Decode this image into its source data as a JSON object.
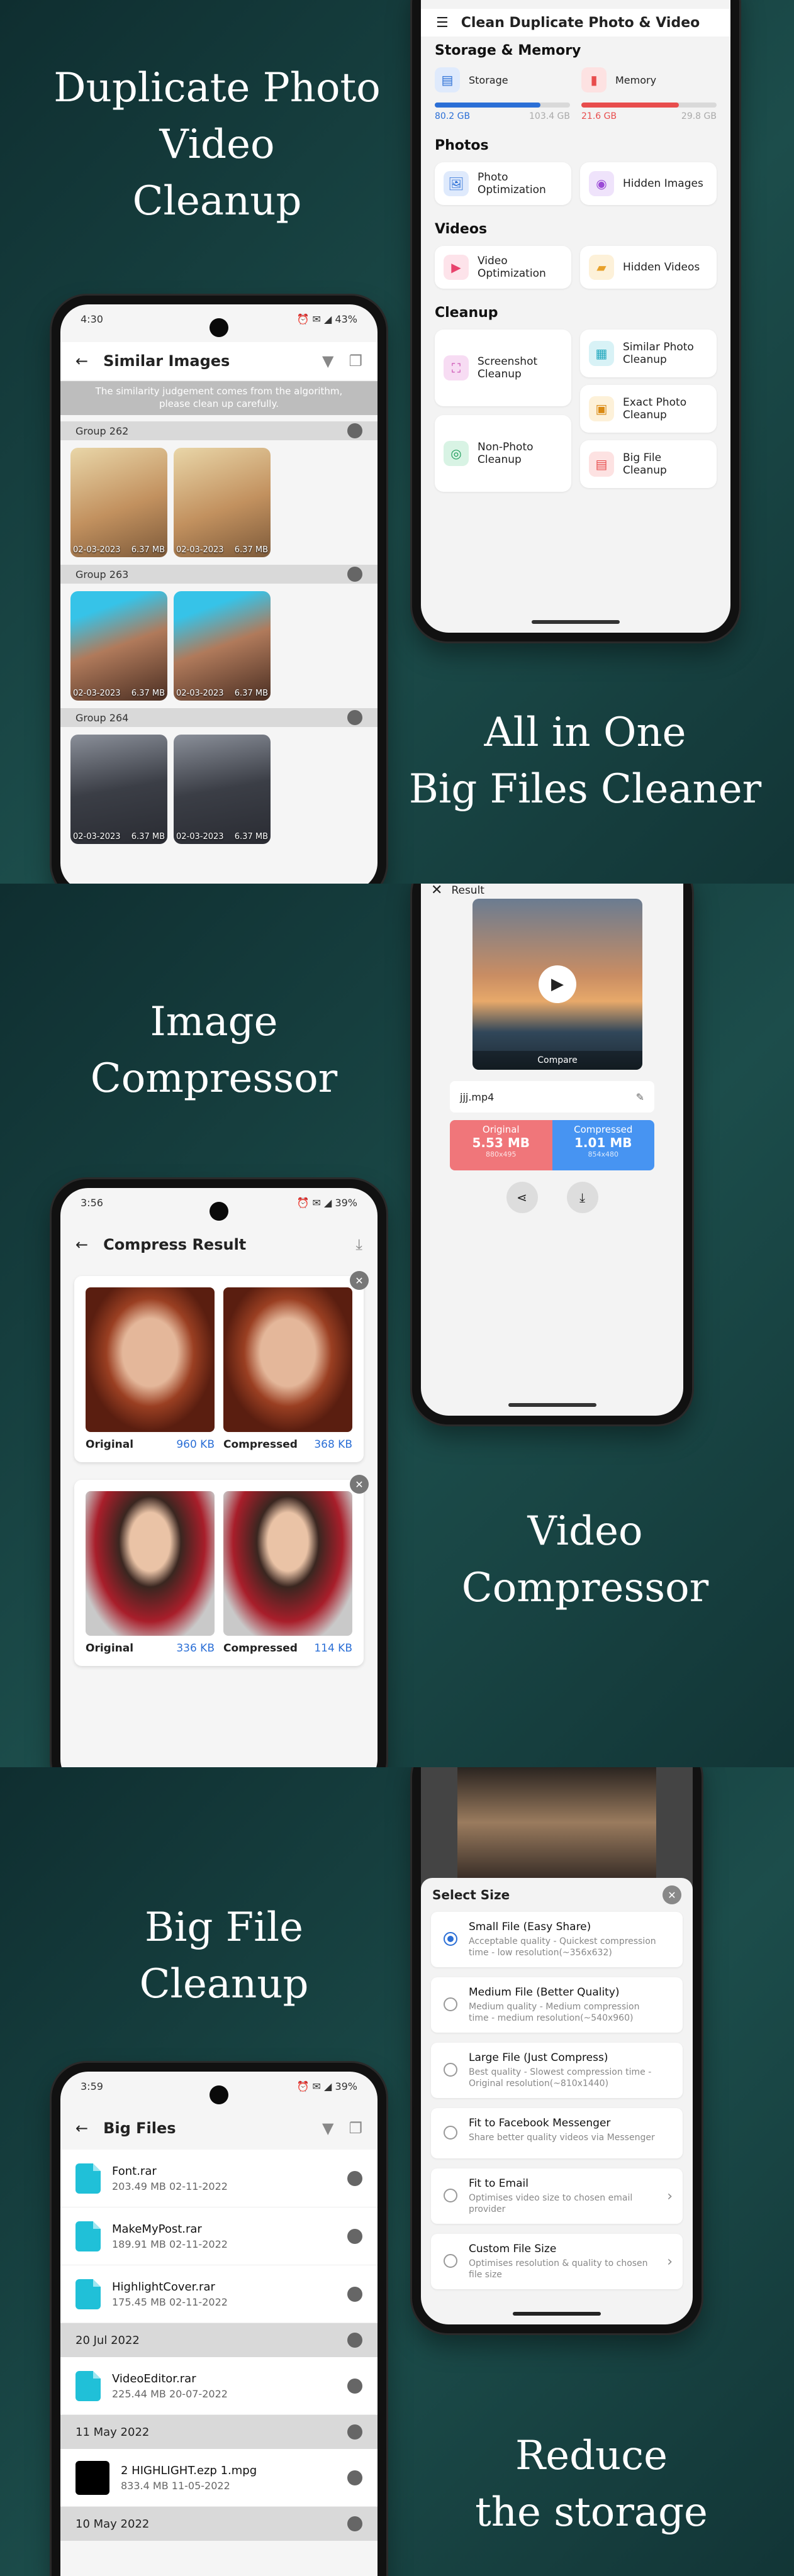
{
  "section1": {
    "headline_lines": [
      "Duplicate Photo",
      "Video",
      "Cleanup"
    ],
    "footer_lines": [
      "All in One",
      "Big Files Cleaner"
    ],
    "similar": {
      "time": "4:30",
      "status_right": "⏰ ✉ ◢ 43%",
      "title": "Similar Images",
      "notice": "The similarity judgement comes from the algorithm, please clean up carefully.",
      "groups": [
        {
          "label": "Group 262",
          "items": [
            {
              "date": "02-03-2023",
              "size": "6.37 MB"
            },
            {
              "date": "02-03-2023",
              "size": "6.37 MB"
            }
          ]
        },
        {
          "label": "Group 263",
          "items": [
            {
              "date": "02-03-2023",
              "size": "6.37 MB"
            },
            {
              "date": "02-03-2023",
              "size": "6.37 MB"
            }
          ]
        },
        {
          "label": "Group 264",
          "items": [
            {
              "date": "02-03-2023",
              "size": "6.37 MB"
            },
            {
              "date": "02-03-2023",
              "size": "6.37 MB"
            }
          ]
        }
      ]
    },
    "menu": {
      "title": "Clean Duplicate Photo & Video",
      "storage_section": "Storage & Memory",
      "storage": {
        "label": "Storage",
        "used": "80.2 GB",
        "total": "103.4 GB",
        "fill": 0.78
      },
      "memory": {
        "label": "Memory",
        "used": "21.6 GB",
        "total": "29.8 GB",
        "fill": 0.72
      },
      "photos_section": "Photos",
      "photo_optimization": "Photo Optimization",
      "hidden_images": "Hidden Images",
      "videos_section": "Videos",
      "video_optimization": "Video Optimization",
      "hidden_videos": "Hidden Videos",
      "cleanup_section": "Cleanup",
      "screenshot_cleanup": "Screenshot Cleanup",
      "similar_photo_cleanup": "Similar Photo Cleanup",
      "exact_photo_cleanup": "Exact Photo Cleanup",
      "non_photo_cleanup": "Non-Photo Cleanup",
      "big_file_cleanup": "Big File Cleanup"
    }
  },
  "section2": {
    "headline_lines": [
      "Image",
      "Compressor"
    ],
    "footer_lines": [
      "Video",
      "Compressor"
    ],
    "video_result": {
      "title": "Result",
      "compare": "Compare",
      "filename": "jjj.mp4",
      "original_label": "Original",
      "original_size": "5.53 MB",
      "original_res": "880x495",
      "compressed_label": "Compressed",
      "compressed_size": "1.01 MB",
      "compressed_res": "854x480"
    },
    "compress_result": {
      "time": "3:56",
      "status_right": "⏰ ✉ ◢ 39%",
      "title": "Compress Result",
      "pairs": [
        {
          "orig_label": "Original",
          "orig_size": "960 KB",
          "comp_label": "Compressed",
          "comp_size": "368 KB"
        },
        {
          "orig_label": "Original",
          "orig_size": "336 KB",
          "comp_label": "Compressed",
          "comp_size": "114 KB"
        }
      ]
    }
  },
  "section3": {
    "headline_lines": [
      "Big File",
      "Cleanup"
    ],
    "footer_lines": [
      "Reduce",
      "the storage"
    ],
    "select_size": {
      "title": "Select Size",
      "options": [
        {
          "title": "Small File (Easy Share)",
          "desc": "Acceptable quality - Quickest compression time - low resolution(~356x632)"
        },
        {
          "title": "Medium File (Better Quality)",
          "desc": "Medium quality - Medium compression time - medium resolution(~540x960)"
        },
        {
          "title": "Large File (Just Compress)",
          "desc": "Best quality - Slowest compression time - Original resolution(~810x1440)"
        },
        {
          "title": "Fit to Facebook Messenger",
          "desc": "Share better quality videos via Messenger"
        },
        {
          "title": "Fit to Email",
          "desc": "Optimises video size to chosen email provider"
        },
        {
          "title": "Custom File Size",
          "desc": "Optimises resolution & quality to chosen file size"
        }
      ]
    },
    "big_files": {
      "time": "3:59",
      "status_right": "⏰ ✉ ◢ 39%",
      "title": "Big Files",
      "files_top": [
        {
          "name": "Font.rar",
          "meta": "203.49 MB    02-11-2022"
        },
        {
          "name": "MakeMyPost.rar",
          "meta": "189.91 MB    02-11-2022"
        },
        {
          "name": "HighlightCover.rar",
          "meta": "175.45 MB    02-11-2022"
        }
      ],
      "group2": "20 Jul 2022",
      "file2": {
        "name": "VideoEditor.rar",
        "meta": "225.44 MB    20-07-2022"
      },
      "group3": "11 May 2022",
      "file3": {
        "name": "2 HIGHLIGHT.ezp 1.mpg",
        "meta": "833.4 MB    11-05-2022"
      },
      "group4": "10 May 2022"
    }
  }
}
